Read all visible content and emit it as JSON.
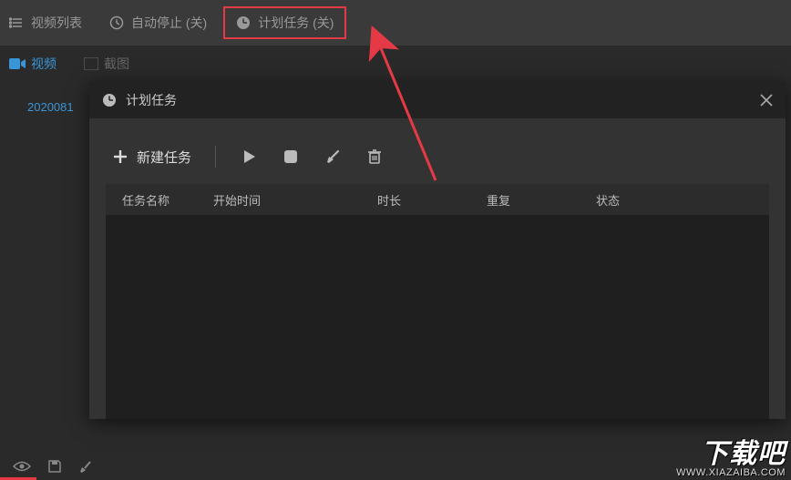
{
  "topbar": {
    "video_list": "视频列表",
    "auto_stop": "自动停止 (关)",
    "scheduled_tasks": "计划任务 (关)"
  },
  "tabs": {
    "video": "视频",
    "screenshot": "截图"
  },
  "file": {
    "name": "2020081"
  },
  "modal": {
    "title": "计划任务",
    "new_task": "新建任务",
    "columns": {
      "name": "任务名称",
      "start": "开始时间",
      "duration": "时长",
      "repeat": "重复",
      "status": "状态"
    }
  },
  "watermark": {
    "brand": "下载吧",
    "url": "WWW.XIAZAIBA.COM"
  }
}
